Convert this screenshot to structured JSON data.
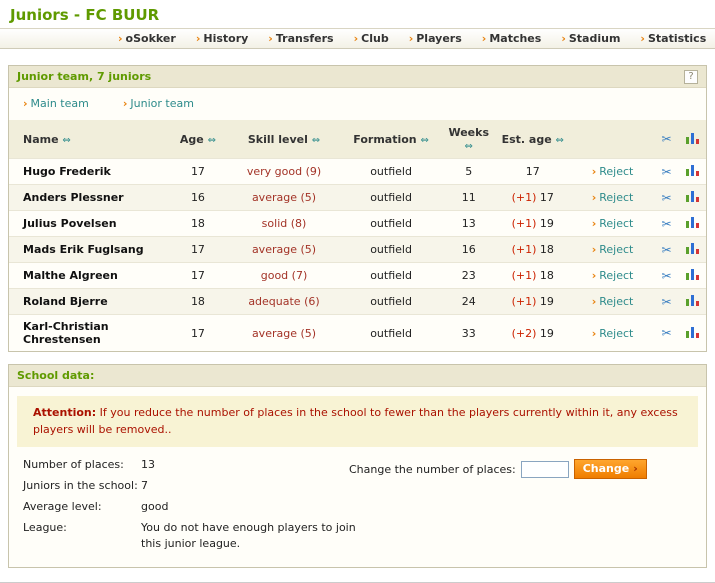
{
  "page": {
    "title": "Juniors - FC BUUR"
  },
  "icons": {
    "arrow": "›",
    "sort": "⇔",
    "help": "?",
    "scissors": "✂"
  },
  "colors": {
    "accent_green": "#5f9a00",
    "link_teal": "#2e8b8b",
    "arrow_orange": "#e8820e",
    "attention_red": "#aa1100",
    "skill_red": "#a33327",
    "button_orange": "#ef7d00",
    "header_beige": "#ebe7d1"
  },
  "nav": {
    "items": [
      "oSokker",
      "History",
      "Transfers",
      "Club",
      "Players",
      "Matches",
      "Stadium",
      "Statistics"
    ]
  },
  "junior_panel": {
    "title": "Junior team, 7 juniors",
    "help": "?",
    "links": {
      "main_team": "Main team",
      "junior_team": "Junior team"
    },
    "table": {
      "headers": [
        "Name",
        "Age",
        "Skill level",
        "Formation",
        "Weeks",
        "Est. age"
      ],
      "reject_label": "Reject",
      "rows": [
        {
          "name": "Hugo Frederik",
          "age": "17",
          "skill": "very good (9)",
          "formation": "outfield",
          "weeks": "5",
          "est_plus": "",
          "est_age": "17"
        },
        {
          "name": "Anders Plessner",
          "age": "16",
          "skill": "average (5)",
          "formation": "outfield",
          "weeks": "11",
          "est_plus": "(+1)",
          "est_age": "17"
        },
        {
          "name": "Julius Povelsen",
          "age": "18",
          "skill": "solid (8)",
          "formation": "outfield",
          "weeks": "13",
          "est_plus": "(+1)",
          "est_age": "19"
        },
        {
          "name": "Mads Erik Fuglsang",
          "age": "17",
          "skill": "average (5)",
          "formation": "outfield",
          "weeks": "16",
          "est_plus": "(+1)",
          "est_age": "18"
        },
        {
          "name": "Malthe Algreen",
          "age": "17",
          "skill": "good (7)",
          "formation": "outfield",
          "weeks": "23",
          "est_plus": "(+1)",
          "est_age": "18"
        },
        {
          "name": "Roland Bjerre",
          "age": "18",
          "skill": "adequate (6)",
          "formation": "outfield",
          "weeks": "24",
          "est_plus": "(+1)",
          "est_age": "19"
        },
        {
          "name": "Karl-Christian Chrestensen",
          "age": "17",
          "skill": "average (5)",
          "formation": "outfield",
          "weeks": "33",
          "est_plus": "(+2)",
          "est_age": "19"
        }
      ]
    }
  },
  "school_panel": {
    "title": "School data:",
    "attention_label": "Attention:",
    "attention_text": "If you reduce the number of places in the school to fewer than the players currently within it, any excess players will be removed..",
    "fields": [
      {
        "label": "Number of places:",
        "value": "13"
      },
      {
        "label": "Juniors in the school:",
        "value": "7"
      },
      {
        "label": "Average level:",
        "value": "good"
      },
      {
        "label": "League:",
        "value": "You do not have enough players to join this junior league."
      }
    ],
    "change": {
      "label": "Change the number of places:",
      "button": "Change"
    }
  }
}
